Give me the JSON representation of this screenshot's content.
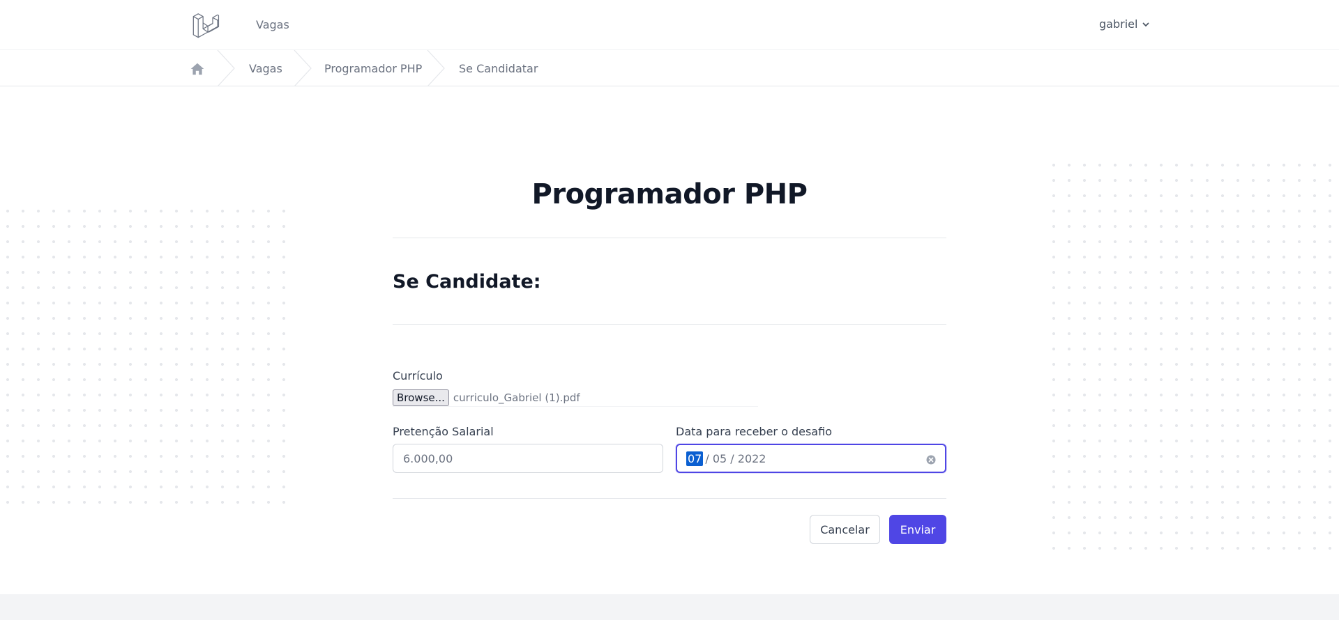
{
  "nav": {
    "brand_icon": "laravel-logo",
    "link": "Vagas",
    "user_name": "gabriel",
    "user_menu_icon": "chevron-down-icon"
  },
  "breadcrumb": {
    "home_icon": "home-icon",
    "items": [
      "Vagas",
      "Programador PHP",
      "Se Candidatar"
    ]
  },
  "page": {
    "job_title": "Programador PHP",
    "section_title": "Se Candidate:"
  },
  "form": {
    "resume": {
      "label": "Currículo",
      "button_label": "Browse...",
      "file_name": "curriculo_Gabriel (1).pdf"
    },
    "salary": {
      "label": "Pretenção Salarial",
      "placeholder": "6.000,00"
    },
    "challenge_date": {
      "label": "Data para receber o desafio",
      "day": "07",
      "rest": "/ 05 / 2022"
    },
    "cancel_label": "Cancelar",
    "submit_label": "Enviar"
  },
  "colors": {
    "accent": "#4f46e5",
    "text": "#111827",
    "muted": "#6b7280"
  }
}
